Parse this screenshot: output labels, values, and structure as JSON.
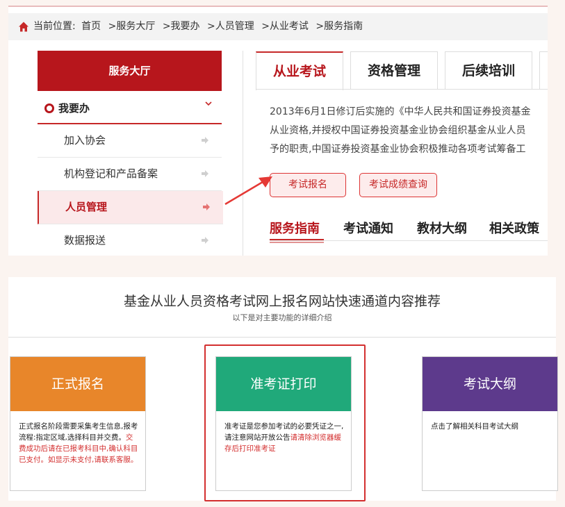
{
  "breadcrumb": {
    "prefix": "当前位置:",
    "items": [
      "首页",
      "服务大厅",
      "我要办",
      "人员管理",
      "从业考试",
      "服务指南"
    ],
    "sep": ">"
  },
  "sidebar": {
    "header": "服务大厅",
    "section": "我要办",
    "items": [
      {
        "label": "加入协会",
        "active": false
      },
      {
        "label": "机构登记和产品备案",
        "active": false
      },
      {
        "label": "人员管理",
        "active": true
      },
      {
        "label": "数据报送",
        "active": false
      }
    ]
  },
  "tabs": [
    "从业考试",
    "资格管理",
    "后续培训"
  ],
  "description": [
    "2013年6月1日修订后实施的《中华人民共和国证券投资基金",
    "从业资格,并授权中国证券投资基金业协会组织基金从业人员",
    "予的职责,中国证券投资基金业协会积极推动各项考试筹备工"
  ],
  "actions": {
    "register": "考试报名",
    "score": "考试成绩查询"
  },
  "subtabs": [
    "服务指南",
    "考试通知",
    "教材大纲",
    "相关政策"
  ],
  "lower": {
    "title": "基金从业人员资格考试网上报名网站快速通道内容推荐",
    "subtitle": "以下是对主要功能的详细介绍",
    "cards": [
      {
        "title": "正式报名",
        "color": "#e8862a",
        "text": "正式报名阶段需要采集考生信息,报考流程:指定区域,选择科目并交费。",
        "warn": "交费成功后请在已报考科目中,确认科目已支付。如显示未支付,请联系客服。"
      },
      {
        "title": "准考证打印",
        "color": "#20a97a",
        "text": "准考证是您参加考试的必要凭证之一,请注意网站开放公告",
        "warn": "请清除浏览器缓存后打印准考证"
      },
      {
        "title": "考试大纲",
        "color": "#5d3a8c",
        "text": "点击了解相关科目考试大纲",
        "warn": ""
      }
    ]
  },
  "colors": {
    "brand_red": "#b7161c",
    "orange": "#e8862a",
    "green": "#20a97a",
    "purple": "#5d3a8c"
  }
}
